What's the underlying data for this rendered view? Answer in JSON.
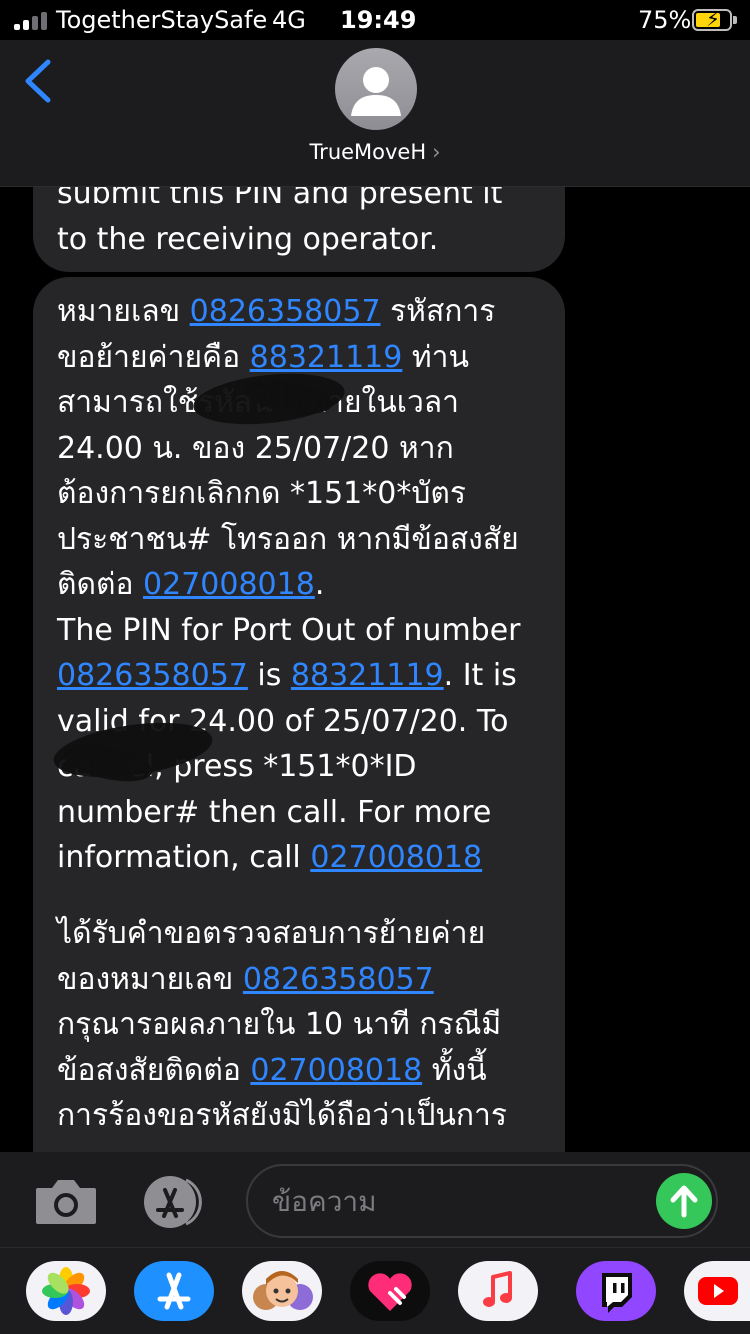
{
  "status_bar": {
    "carrier": "TogetherStaySafe",
    "network": "4G",
    "time": "19:49",
    "battery": "75%",
    "signal_bars": 2,
    "signal_bars_total": 4
  },
  "header": {
    "contact_name": "TrueMoveH",
    "back_icon": "chevron-left-icon",
    "disclosure_icon": "chevron-right-icon"
  },
  "messages": [
    {
      "parts": [
        {
          "text": "submit this PIN and present it\nto the receiving operator."
        }
      ]
    },
    {
      "parts": [
        {
          "text": "หมายเลข "
        },
        {
          "text": "0826358057",
          "link": true
        },
        {
          "text": " รหัสการ\nขอย้ายค่ายคือ "
        },
        {
          "text": "88321119",
          "link": true
        },
        {
          "text": " ท่าน\nสามารถใช้รหัสนี้ได้ภายในเวลา\n24.00 น. ของ 25/07/20 หาก\nต้องการยกเลิกกด *151*0*บัตร\nประชาชน# โทรออก หากมีข้อสงสัย\nติดต่อ "
        },
        {
          "text": "027008018",
          "link": true
        },
        {
          "text": ".\nThe PIN for Port Out of number\n"
        },
        {
          "text": "0826358057",
          "link": true
        },
        {
          "text": " is "
        },
        {
          "text": "88321119",
          "link": true
        },
        {
          "text": ". It is\nvalid for 24.00 of 25/07/20. To\ncancel, press *151*0*ID\nnumber# then call. For more\ninformation, call "
        },
        {
          "text": "027008018",
          "link": true
        }
      ]
    },
    {
      "parts": [
        {
          "text": "ได้รับคำขอตรวจสอบการย้ายค่าย\nของหมายเลข "
        },
        {
          "text": "0826358057",
          "link": true
        },
        {
          "text": "\nกรุณารอผลภายใน 10 นาที กรณีมี\nข้อสงสัยติดต่อ "
        },
        {
          "text": "027008018",
          "link": true
        },
        {
          "text": " ทั้งนี้\nการร้องขอรหัสยังมิได้ถือว่าเป็นการ"
        }
      ]
    }
  ],
  "input_bar": {
    "placeholder": "ข้อความ",
    "camera_icon": "camera-icon",
    "apps_icon": "app-store-icon",
    "send_icon": "send-arrow-up-icon"
  },
  "app_drawer": [
    {
      "name": "photos-app-icon"
    },
    {
      "name": "app-store-app-icon"
    },
    {
      "name": "memoji-app-icon"
    },
    {
      "name": "digital-touch-app-icon"
    },
    {
      "name": "music-app-icon"
    },
    {
      "name": "twitch-app-icon"
    },
    {
      "name": "youtube-app-icon"
    }
  ],
  "colors": {
    "link": "#2f86ff",
    "bubble": "#262628",
    "send": "#35c759",
    "header": "#1c1c1e"
  }
}
